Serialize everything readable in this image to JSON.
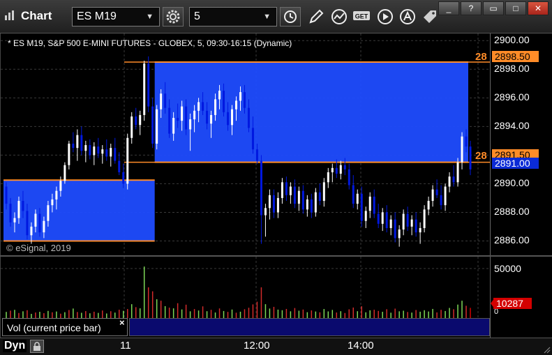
{
  "window": {
    "title": "Chart",
    "symbol": "ES M19",
    "interval": "5",
    "buttons": {
      "minimize": "_",
      "help": "?",
      "restore": "▭",
      "close": "✕"
    }
  },
  "toolbar_icons": [
    "gear-icon",
    "clock-icon",
    "pencil-icon",
    "study-icon",
    "get-icon",
    "play-icon",
    "alert-icon",
    "tag-icon"
  ],
  "chart": {
    "label": "* ES M19, S&P 500 E-MINI FUTURES - GLOBEX, 5, 09:30-16:15 (Dynamic)",
    "watermark": "© eSignal, 2019",
    "price_ticks": [
      "2900.00",
      "2898.00",
      "2896.00",
      "2894.00",
      "2892.00",
      "2890.00",
      "2888.00",
      "2886.00"
    ],
    "level_high_tag": "2898.50",
    "level_low_tag": "2891.50",
    "last_price_tag": "2891.00",
    "level_left_label_high": "28",
    "level_left_label_low": "28",
    "colors": {
      "zone": "#1f4cff",
      "level": "#ff8c28",
      "up": "#ffffff",
      "down": "#0018e0",
      "last": "#0b2bd6"
    }
  },
  "volume": {
    "legend": "Vol (current price bar)",
    "close_glyph": "×",
    "ticks": [
      "50000",
      "0"
    ],
    "last_tag": "10287",
    "colors": {
      "up": "#7ed957",
      "down": "#d42b2b",
      "last": "#d40000"
    }
  },
  "time_axis": {
    "mode": "Dyn",
    "ticks": [
      "11",
      "12:00",
      "14:00"
    ]
  },
  "chart_data": {
    "type": "candlestick",
    "ylim": [
      2885,
      2900.5
    ],
    "levels": [
      2898.5,
      2891.5
    ],
    "zones": [
      {
        "from_bar": 0,
        "to_bar": 36,
        "low": 2886.0,
        "high": 2890.25
      },
      {
        "from_bar": 36,
        "to_bar": 139,
        "low": 2891.5,
        "high": 2898.5
      }
    ],
    "candles": [
      [
        2889.8,
        2890.1,
        2888.2,
        2888.6
      ],
      [
        2888.6,
        2889.0,
        2887.0,
        2887.3
      ],
      [
        2887.3,
        2888.0,
        2886.6,
        2887.6
      ],
      [
        2887.6,
        2889.1,
        2887.2,
        2888.8
      ],
      [
        2888.8,
        2889.5,
        2887.6,
        2888.1
      ],
      [
        2888.1,
        2888.6,
        2886.1,
        2886.4
      ],
      [
        2886.4,
        2887.3,
        2885.8,
        2887.0
      ],
      [
        2887.0,
        2888.2,
        2886.6,
        2887.9
      ],
      [
        2887.9,
        2888.3,
        2886.3,
        2886.6
      ],
      [
        2886.6,
        2887.7,
        2886.2,
        2887.4
      ],
      [
        2887.4,
        2888.8,
        2887.0,
        2888.5
      ],
      [
        2888.5,
        2889.3,
        2888.0,
        2888.9
      ],
      [
        2888.9,
        2889.8,
        2888.2,
        2889.5
      ],
      [
        2889.5,
        2890.5,
        2889.1,
        2890.2
      ],
      [
        2890.2,
        2891.5,
        2890.0,
        2891.3
      ],
      [
        2891.3,
        2893.0,
        2891.0,
        2892.8
      ],
      [
        2892.8,
        2893.6,
        2892.2,
        2892.5
      ],
      [
        2892.5,
        2893.8,
        2891.6,
        2893.4
      ],
      [
        2893.4,
        2894.0,
        2892.0,
        2892.3
      ],
      [
        2892.3,
        2893.0,
        2891.5,
        2892.7
      ],
      [
        2892.7,
        2893.1,
        2891.7,
        2892.0
      ],
      [
        2892.0,
        2892.9,
        2891.3,
        2892.6
      ],
      [
        2892.6,
        2893.2,
        2891.8,
        2892.1
      ],
      [
        2892.1,
        2892.7,
        2891.4,
        2892.4
      ],
      [
        2892.4,
        2893.1,
        2891.6,
        2891.9
      ],
      [
        2891.9,
        2892.8,
        2891.2,
        2892.5
      ],
      [
        2892.5,
        2893.2,
        2891.4,
        2891.6
      ],
      [
        2891.6,
        2892.2,
        2890.6,
        2890.8
      ],
      [
        2890.8,
        2891.4,
        2889.7,
        2890.0
      ],
      [
        2890.0,
        2893.5,
        2889.6,
        2893.2
      ],
      [
        2893.2,
        2895.0,
        2892.8,
        2894.7
      ],
      [
        2894.7,
        2895.3,
        2893.8,
        2894.1
      ],
      [
        2894.1,
        2895.1,
        2893.4,
        2894.8
      ],
      [
        2894.8,
        2898.6,
        2894.4,
        2898.4
      ],
      [
        2898.4,
        2898.9,
        2895.0,
        2895.4
      ],
      [
        2895.4,
        2896.0,
        2892.5,
        2892.8
      ],
      [
        2892.8,
        2895.5,
        2892.4,
        2895.2
      ],
      [
        2895.2,
        2896.6,
        2894.6,
        2896.3
      ],
      [
        2896.3,
        2897.1,
        2894.9,
        2895.3
      ],
      [
        2895.3,
        2895.9,
        2893.2,
        2893.5
      ],
      [
        2893.5,
        2895.0,
        2893.0,
        2894.6
      ],
      [
        2894.6,
        2895.6,
        2893.9,
        2894.4
      ],
      [
        2894.4,
        2895.8,
        2893.7,
        2895.4
      ],
      [
        2895.4,
        2895.9,
        2893.4,
        2893.8
      ],
      [
        2893.8,
        2894.9,
        2892.3,
        2894.5
      ],
      [
        2894.5,
        2895.5,
        2893.6,
        2895.1
      ],
      [
        2895.1,
        2896.0,
        2894.3,
        2895.7
      ],
      [
        2895.7,
        2896.4,
        2894.8,
        2895.1
      ],
      [
        2895.1,
        2895.7,
        2893.8,
        2894.2
      ],
      [
        2894.2,
        2895.1,
        2893.2,
        2894.8
      ],
      [
        2894.8,
        2896.3,
        2894.4,
        2895.9
      ],
      [
        2895.9,
        2896.9,
        2895.2,
        2896.5
      ],
      [
        2896.5,
        2897.0,
        2894.7,
        2895.0
      ],
      [
        2895.0,
        2895.7,
        2893.7,
        2894.1
      ],
      [
        2894.1,
        2895.5,
        2893.4,
        2895.2
      ],
      [
        2895.2,
        2896.1,
        2894.4,
        2895.8
      ],
      [
        2895.8,
        2896.8,
        2895.1,
        2896.4
      ],
      [
        2896.4,
        2896.9,
        2894.9,
        2895.3
      ],
      [
        2895.3,
        2895.9,
        2893.6,
        2893.9
      ],
      [
        2893.9,
        2894.7,
        2892.1,
        2892.4
      ],
      [
        2892.4,
        2892.8,
        2891.4,
        2891.6
      ],
      [
        2891.6,
        2892.0,
        2885.8,
        2887.8
      ],
      [
        2887.8,
        2888.6,
        2886.3,
        2888.3
      ],
      [
        2888.3,
        2889.6,
        2887.5,
        2889.2
      ],
      [
        2889.2,
        2889.6,
        2887.6,
        2888.0
      ],
      [
        2888.0,
        2889.4,
        2887.6,
        2889.0
      ],
      [
        2889.0,
        2890.4,
        2888.6,
        2890.1
      ],
      [
        2890.1,
        2890.5,
        2888.8,
        2889.2
      ],
      [
        2889.2,
        2890.1,
        2888.6,
        2889.8
      ],
      [
        2889.8,
        2890.3,
        2888.3,
        2888.6
      ],
      [
        2888.6,
        2889.8,
        2888.1,
        2889.5
      ],
      [
        2889.5,
        2889.9,
        2887.9,
        2888.2
      ],
      [
        2888.2,
        2889.2,
        2887.7,
        2888.9
      ],
      [
        2888.9,
        2889.3,
        2887.6,
        2888.0
      ],
      [
        2888.0,
        2889.7,
        2887.7,
        2889.4
      ],
      [
        2889.4,
        2890.0,
        2888.5,
        2888.8
      ],
      [
        2888.8,
        2890.4,
        2888.4,
        2890.1
      ],
      [
        2890.1,
        2891.1,
        2889.7,
        2890.8
      ],
      [
        2890.8,
        2891.4,
        2890.1,
        2891.1
      ],
      [
        2891.1,
        2891.7,
        2890.4,
        2890.7
      ],
      [
        2890.7,
        2891.6,
        2890.3,
        2891.3
      ],
      [
        2891.3,
        2891.8,
        2890.6,
        2891.0
      ],
      [
        2891.0,
        2891.4,
        2889.6,
        2889.9
      ],
      [
        2889.9,
        2890.6,
        2888.3,
        2888.6
      ],
      [
        2888.6,
        2889.6,
        2888.2,
        2889.3
      ],
      [
        2889.3,
        2889.8,
        2887.0,
        2887.4
      ],
      [
        2887.4,
        2888.4,
        2886.9,
        2888.1
      ],
      [
        2888.1,
        2889.4,
        2887.6,
        2889.1
      ],
      [
        2889.1,
        2889.6,
        2887.6,
        2887.9
      ],
      [
        2887.9,
        2888.6,
        2886.9,
        2887.2
      ],
      [
        2887.2,
        2888.3,
        2886.7,
        2888.0
      ],
      [
        2888.0,
        2888.5,
        2886.6,
        2886.9
      ],
      [
        2886.9,
        2887.8,
        2886.4,
        2887.5
      ],
      [
        2887.5,
        2888.0,
        2885.9,
        2886.2
      ],
      [
        2886.2,
        2887.1,
        2885.6,
        2886.8
      ],
      [
        2886.8,
        2888.2,
        2886.4,
        2887.9
      ],
      [
        2887.9,
        2888.4,
        2886.7,
        2887.0
      ],
      [
        2887.0,
        2887.8,
        2886.4,
        2887.5
      ],
      [
        2887.5,
        2888.0,
        2886.3,
        2886.6
      ],
      [
        2886.6,
        2887.3,
        2885.8,
        2886.9
      ],
      [
        2886.9,
        2888.5,
        2886.6,
        2888.2
      ],
      [
        2888.2,
        2889.1,
        2887.8,
        2888.8
      ],
      [
        2888.8,
        2889.9,
        2888.4,
        2889.6
      ],
      [
        2889.6,
        2890.3,
        2889.0,
        2889.2
      ],
      [
        2889.2,
        2889.9,
        2888.2,
        2888.5
      ],
      [
        2888.5,
        2890.0,
        2888.1,
        2889.8
      ],
      [
        2889.8,
        2890.8,
        2889.4,
        2890.5
      ],
      [
        2890.5,
        2891.3,
        2889.8,
        2890.1
      ],
      [
        2890.1,
        2891.8,
        2889.8,
        2891.5
      ],
      [
        2891.5,
        2893.6,
        2891.0,
        2893.3
      ],
      [
        2893.3,
        2893.8,
        2892.2,
        2892.6
      ],
      [
        2892.6,
        2893.0,
        2890.6,
        2891.0
      ]
    ],
    "volume_max": 62000,
    "volume": [
      [
        6200,
        1
      ],
      [
        7500,
        0
      ],
      [
        8300,
        1
      ],
      [
        5100,
        0
      ],
      [
        6800,
        1
      ],
      [
        7900,
        0
      ],
      [
        4200,
        1
      ],
      [
        5600,
        0
      ],
      [
        6300,
        1
      ],
      [
        4900,
        0
      ],
      [
        7200,
        1
      ],
      [
        5800,
        0
      ],
      [
        6600,
        1
      ],
      [
        4400,
        0
      ],
      [
        5900,
        1
      ],
      [
        8100,
        0
      ],
      [
        9600,
        1
      ],
      [
        6100,
        0
      ],
      [
        5300,
        1
      ],
      [
        7000,
        0
      ],
      [
        4800,
        1
      ],
      [
        6400,
        0
      ],
      [
        5200,
        1
      ],
      [
        7600,
        0
      ],
      [
        4600,
        1
      ],
      [
        6900,
        0
      ],
      [
        5500,
        1
      ],
      [
        8400,
        0
      ],
      [
        7300,
        1
      ],
      [
        9100,
        0
      ],
      [
        14000,
        1
      ],
      [
        11000,
        0
      ],
      [
        9800,
        1
      ],
      [
        52000,
        1
      ],
      [
        31000,
        0
      ],
      [
        27000,
        0
      ],
      [
        19000,
        1
      ],
      [
        17500,
        0
      ],
      [
        12000,
        1
      ],
      [
        10500,
        0
      ],
      [
        9800,
        1
      ],
      [
        15000,
        0
      ],
      [
        8700,
        1
      ],
      [
        13500,
        0
      ],
      [
        6800,
        1
      ],
      [
        9100,
        0
      ],
      [
        7600,
        1
      ],
      [
        11800,
        0
      ],
      [
        6900,
        1
      ],
      [
        8300,
        0
      ],
      [
        5600,
        1
      ],
      [
        9700,
        0
      ],
      [
        7100,
        1
      ],
      [
        6200,
        0
      ],
      [
        8600,
        1
      ],
      [
        5400,
        0
      ],
      [
        6400,
        1
      ],
      [
        8900,
        0
      ],
      [
        10400,
        0
      ],
      [
        13800,
        0
      ],
      [
        16500,
        0
      ],
      [
        31000,
        0
      ],
      [
        14000,
        1
      ],
      [
        9600,
        1
      ],
      [
        11300,
        0
      ],
      [
        8500,
        1
      ],
      [
        7900,
        1
      ],
      [
        9200,
        0
      ],
      [
        6800,
        1
      ],
      [
        10100,
        0
      ],
      [
        7400,
        1
      ],
      [
        8600,
        0
      ],
      [
        5900,
        1
      ],
      [
        7700,
        0
      ],
      [
        6600,
        1
      ],
      [
        5800,
        0
      ],
      [
        9100,
        1
      ],
      [
        6700,
        1
      ],
      [
        8200,
        1
      ],
      [
        5600,
        0
      ],
      [
        6900,
        1
      ],
      [
        5100,
        0
      ],
      [
        8800,
        0
      ],
      [
        10600,
        0
      ],
      [
        6900,
        1
      ],
      [
        11900,
        0
      ],
      [
        5800,
        1
      ],
      [
        7800,
        1
      ],
      [
        8400,
        0
      ],
      [
        7200,
        0
      ],
      [
        6300,
        1
      ],
      [
        8900,
        0
      ],
      [
        5400,
        1
      ],
      [
        9500,
        0
      ],
      [
        6800,
        1
      ],
      [
        7400,
        1
      ],
      [
        6100,
        0
      ],
      [
        5500,
        1
      ],
      [
        8100,
        0
      ],
      [
        6400,
        1
      ],
      [
        7900,
        1
      ],
      [
        6600,
        1
      ],
      [
        9200,
        1
      ],
      [
        5700,
        0
      ],
      [
        8300,
        0
      ],
      [
        7100,
        1
      ],
      [
        10200,
        1
      ],
      [
        8900,
        0
      ],
      [
        13600,
        1
      ],
      [
        17500,
        1
      ],
      [
        12400,
        0
      ],
      [
        10287,
        0
      ]
    ]
  }
}
